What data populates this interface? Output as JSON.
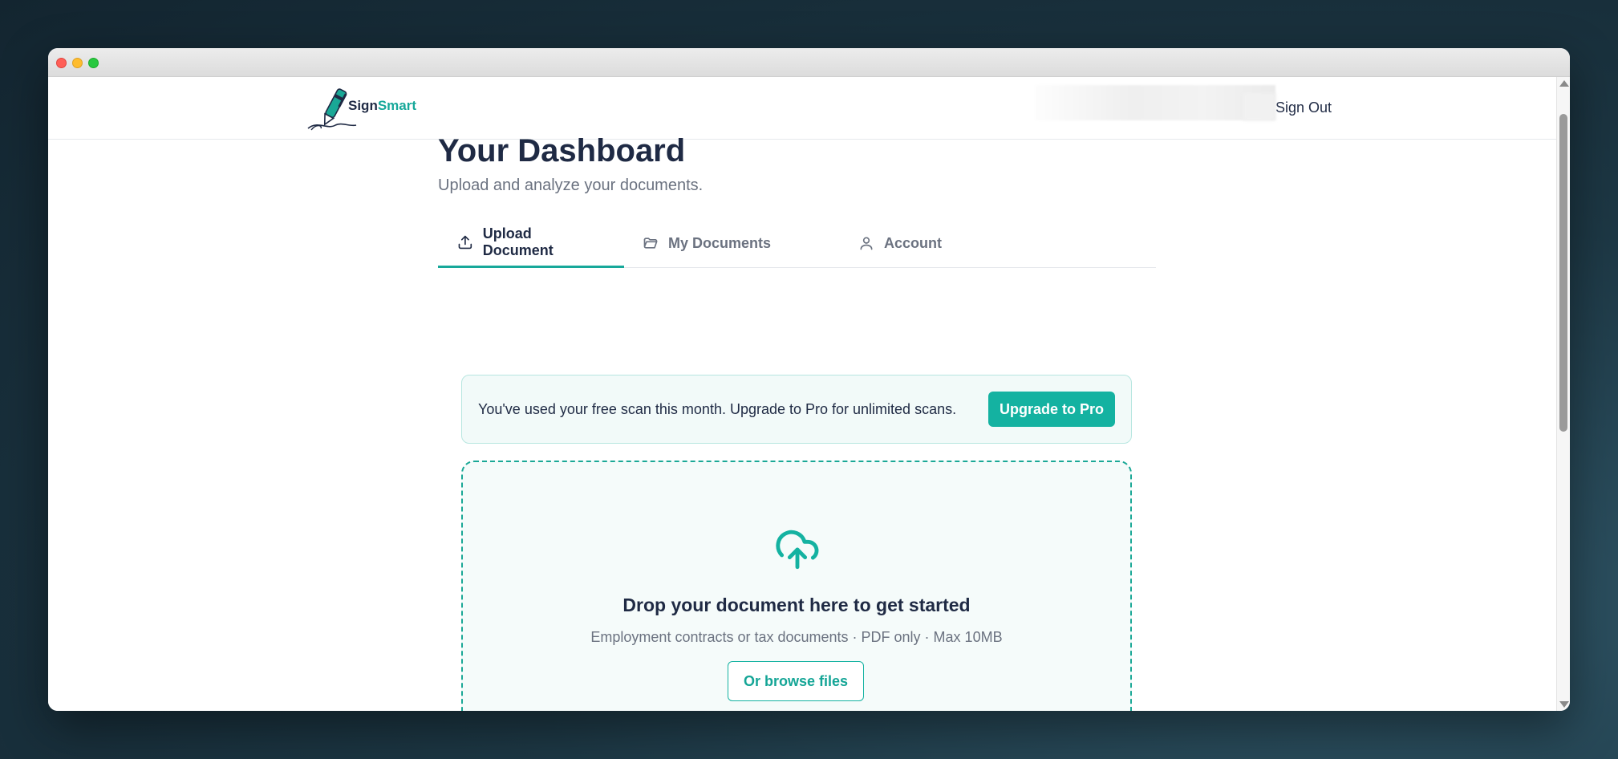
{
  "brand": {
    "sign": "Sign",
    "smart": "Smart"
  },
  "header": {
    "signout_label": "Sign Out"
  },
  "page": {
    "title": "Your Dashboard",
    "subtitle": "Upload and analyze your documents."
  },
  "tabs": [
    {
      "label": "Upload Document",
      "icon": "upload-icon",
      "active": true
    },
    {
      "label": "My Documents",
      "icon": "folder-icon",
      "active": false
    },
    {
      "label": "Account",
      "icon": "user-icon",
      "active": false
    }
  ],
  "notice": {
    "text": "You've used your free scan this month. Upgrade to Pro for unlimited scans.",
    "button_label": "Upgrade to Pro"
  },
  "dropzone": {
    "icon": "cloud-upload-icon",
    "title": "Drop your document here to get started",
    "subtitle": "Employment contracts or tax documents · PDF only · Max 10MB",
    "browse_label": "Or browse files"
  },
  "colors": {
    "accent": "#14b2a1",
    "text_dark": "#1f2a44",
    "text_muted": "#6b7280"
  }
}
